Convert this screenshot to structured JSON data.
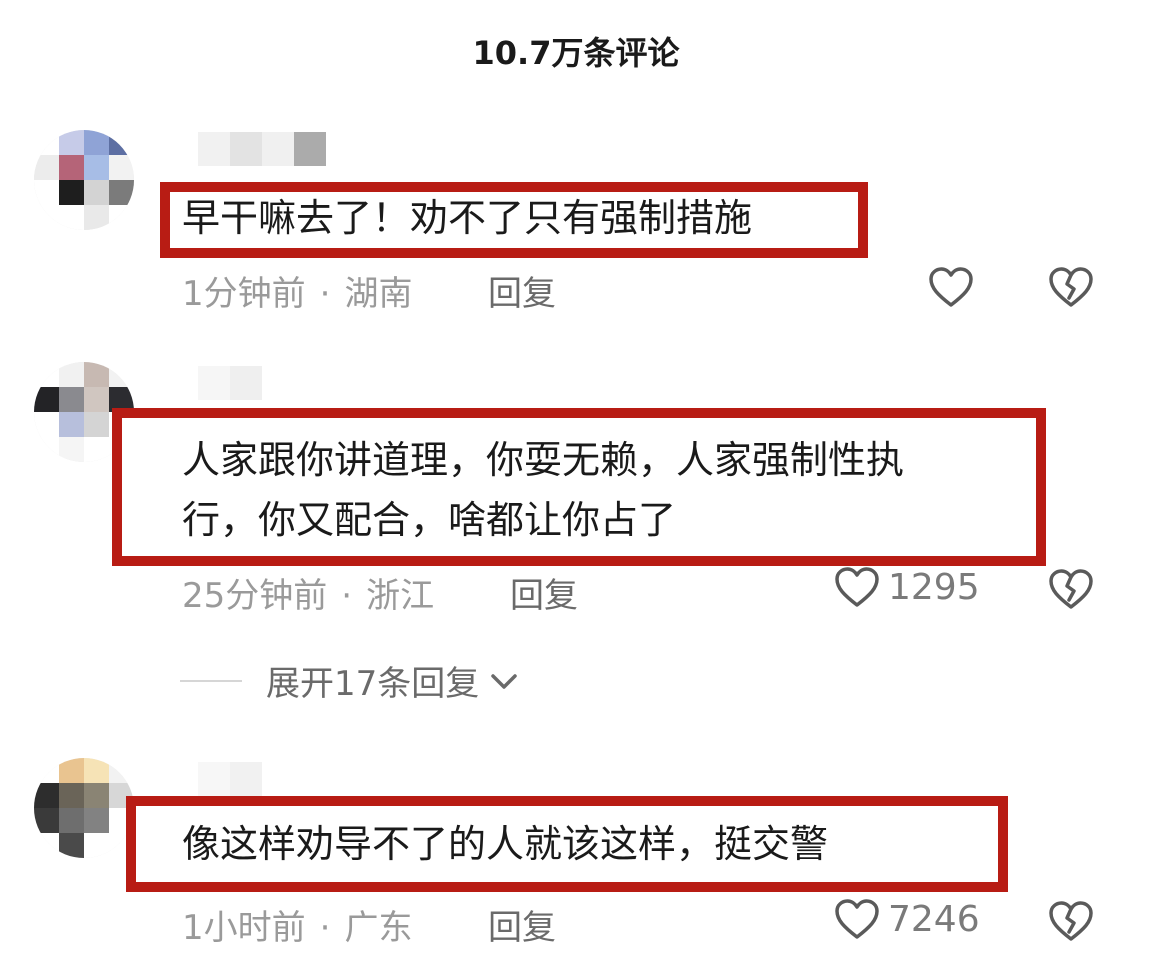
{
  "header": {
    "title": "10.7万条评论"
  },
  "comments": [
    {
      "text_lines": [
        "早干嘛去了！劝不了只有强制措施"
      ],
      "time": "1分钟前",
      "location": "湖南",
      "reply_label": "回复",
      "like_count": "",
      "avatar_colors": [
        "#ffffff",
        "#c6cbe8",
        "#8fa3d6",
        "#5d6fa3",
        "#ececec",
        "#b56478",
        "#a7bde6",
        "#f2f2f2",
        "#ffffff",
        "#1e1e1e",
        "#d3d3d3",
        "#7b7b7b",
        "#ffffff",
        "#ffffff",
        "#e9e9e9",
        "#ffffff"
      ],
      "name_colors": [
        "#f1f1f1",
        "#e3e3e3",
        "#f0f0f0",
        "#ababab"
      ]
    },
    {
      "text_lines": [
        "人家跟你讲道理，你耍无赖，人家强制性执",
        "行，你又配合，啥都让你占了"
      ],
      "time": "25分钟前",
      "location": "浙江",
      "reply_label": "回复",
      "like_count": "1295",
      "expand_label": "展开17条回复",
      "avatar_colors": [
        "#ffffff",
        "#f1f1f1",
        "#c7b9b2",
        "#f2f2f2",
        "#232326",
        "#8a8a8f",
        "#d0c6c0",
        "#2c2c30",
        "#ffffff",
        "#b7bfdc",
        "#d4d4d4",
        "#ffffff",
        "#ffffff",
        "#f5f5f5",
        "#ffffff",
        "#ffffff"
      ],
      "name_colors": [
        "#f6f6f6",
        "#efefef",
        "#ffffff",
        "#ffffff"
      ]
    },
    {
      "text_lines": [
        "像这样劝导不了的人就该这样，挺交警"
      ],
      "time": "1小时前",
      "location": "广东",
      "reply_label": "回复",
      "like_count": "7246",
      "avatar_colors": [
        "#ffffff",
        "#e9c490",
        "#f6e3b6",
        "#f2f2f2",
        "#2d2d2d",
        "#6a6458",
        "#8a8474",
        "#d7d7d7",
        "#3a3a3a",
        "#6e6e6e",
        "#828282",
        "#ffffff",
        "#ffffff",
        "#4a4a4a",
        "#ffffff",
        "#ffffff"
      ],
      "name_colors": [
        "#f7f7f7",
        "#f1f1f1",
        "#ffffff",
        "#ffffff"
      ]
    }
  ],
  "icons": {
    "like": "heart-outline-icon",
    "dislike": "broken-heart-icon",
    "expand": "chevron-down-icon"
  },
  "colors": {
    "highlight_box": "#b81c14",
    "meta_text": "#9a9a9a",
    "icon_stroke": "#5a5a5a"
  }
}
